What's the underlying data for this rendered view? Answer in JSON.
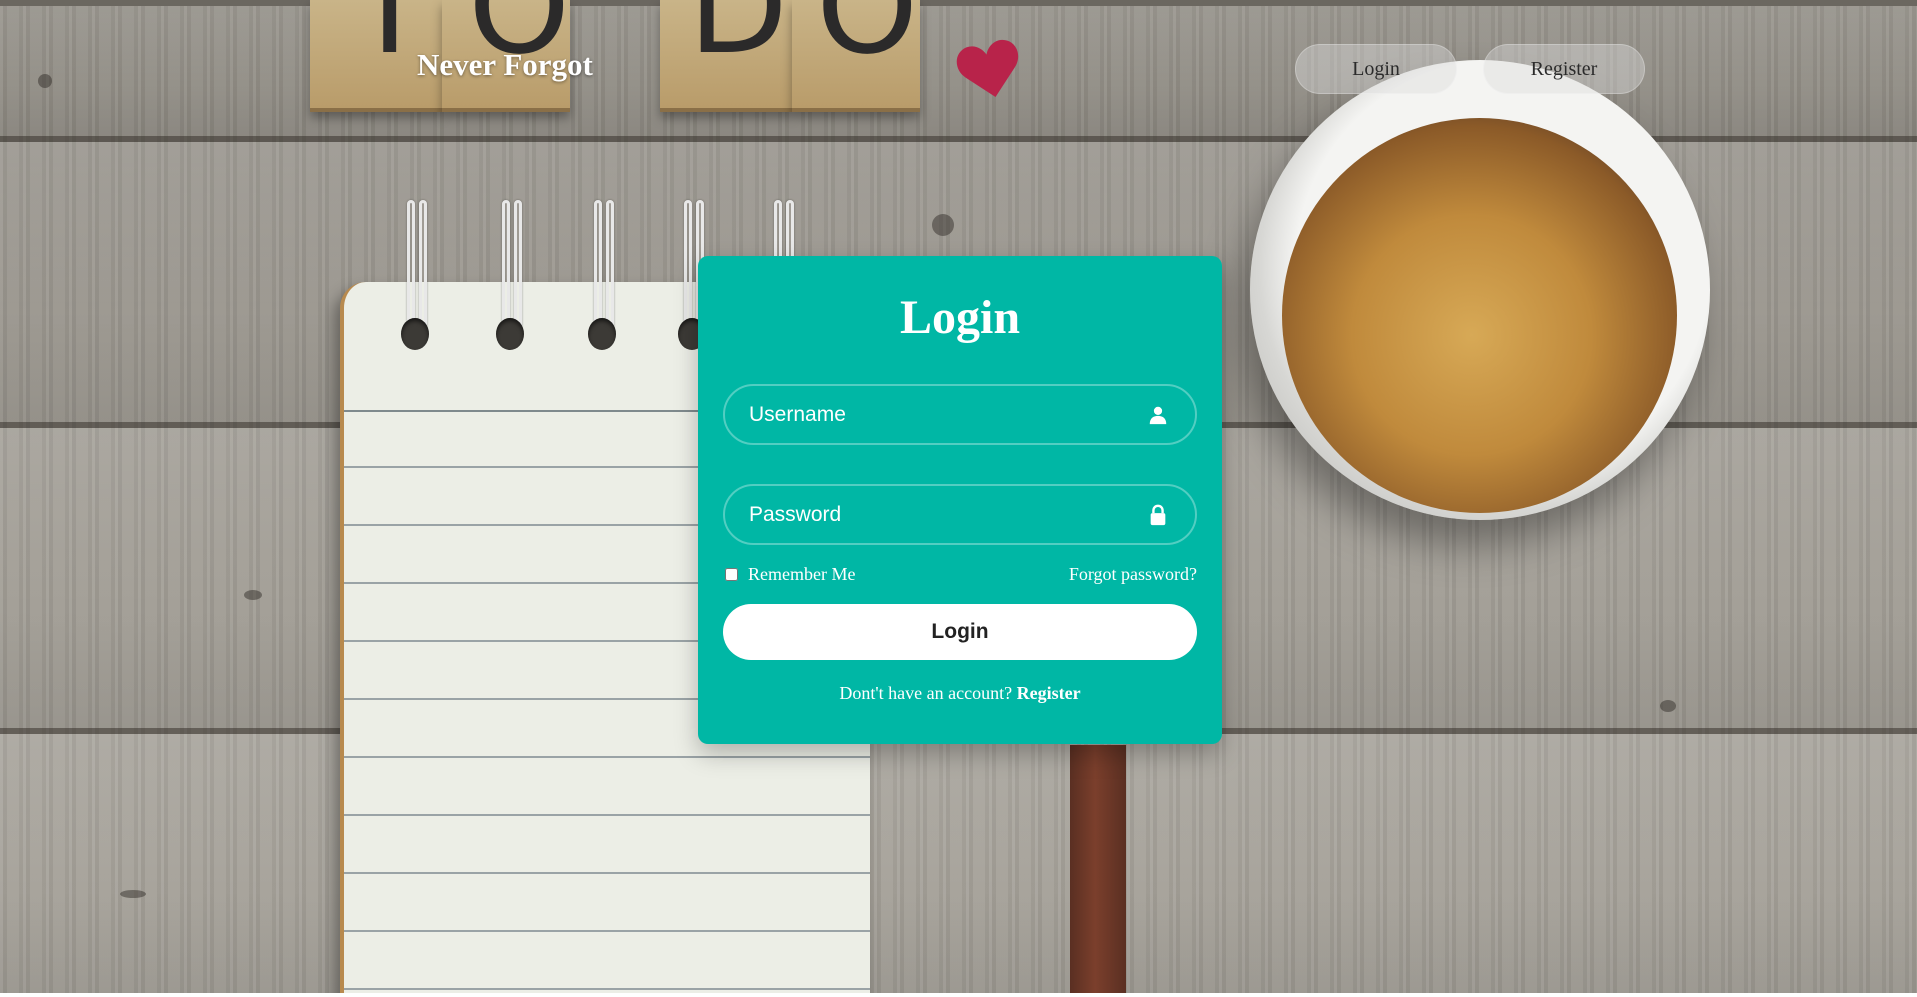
{
  "header": {
    "brand": "Never Forgot",
    "nav": {
      "login_label": "Login",
      "register_label": "Register"
    }
  },
  "background": {
    "tile_letters": [
      "T",
      "O",
      "D",
      "O"
    ],
    "icons": [
      "heart-icon",
      "notepad",
      "coffee-mug",
      "pencil"
    ]
  },
  "login_card": {
    "title": "Login",
    "username": {
      "placeholder": "Username",
      "value": "",
      "icon": "user-icon"
    },
    "password": {
      "placeholder": "Password",
      "value": "",
      "icon": "lock-icon"
    },
    "remember_label": "Remember Me",
    "remember_checked": false,
    "forgot_label": "Forgot password?",
    "submit_label": "Login",
    "signup_prompt": "Dont't have an account?",
    "signup_link": "Register"
  },
  "colors": {
    "card": "#00b7a5",
    "button": "#ffffff",
    "text_on_card": "#ffffff"
  }
}
